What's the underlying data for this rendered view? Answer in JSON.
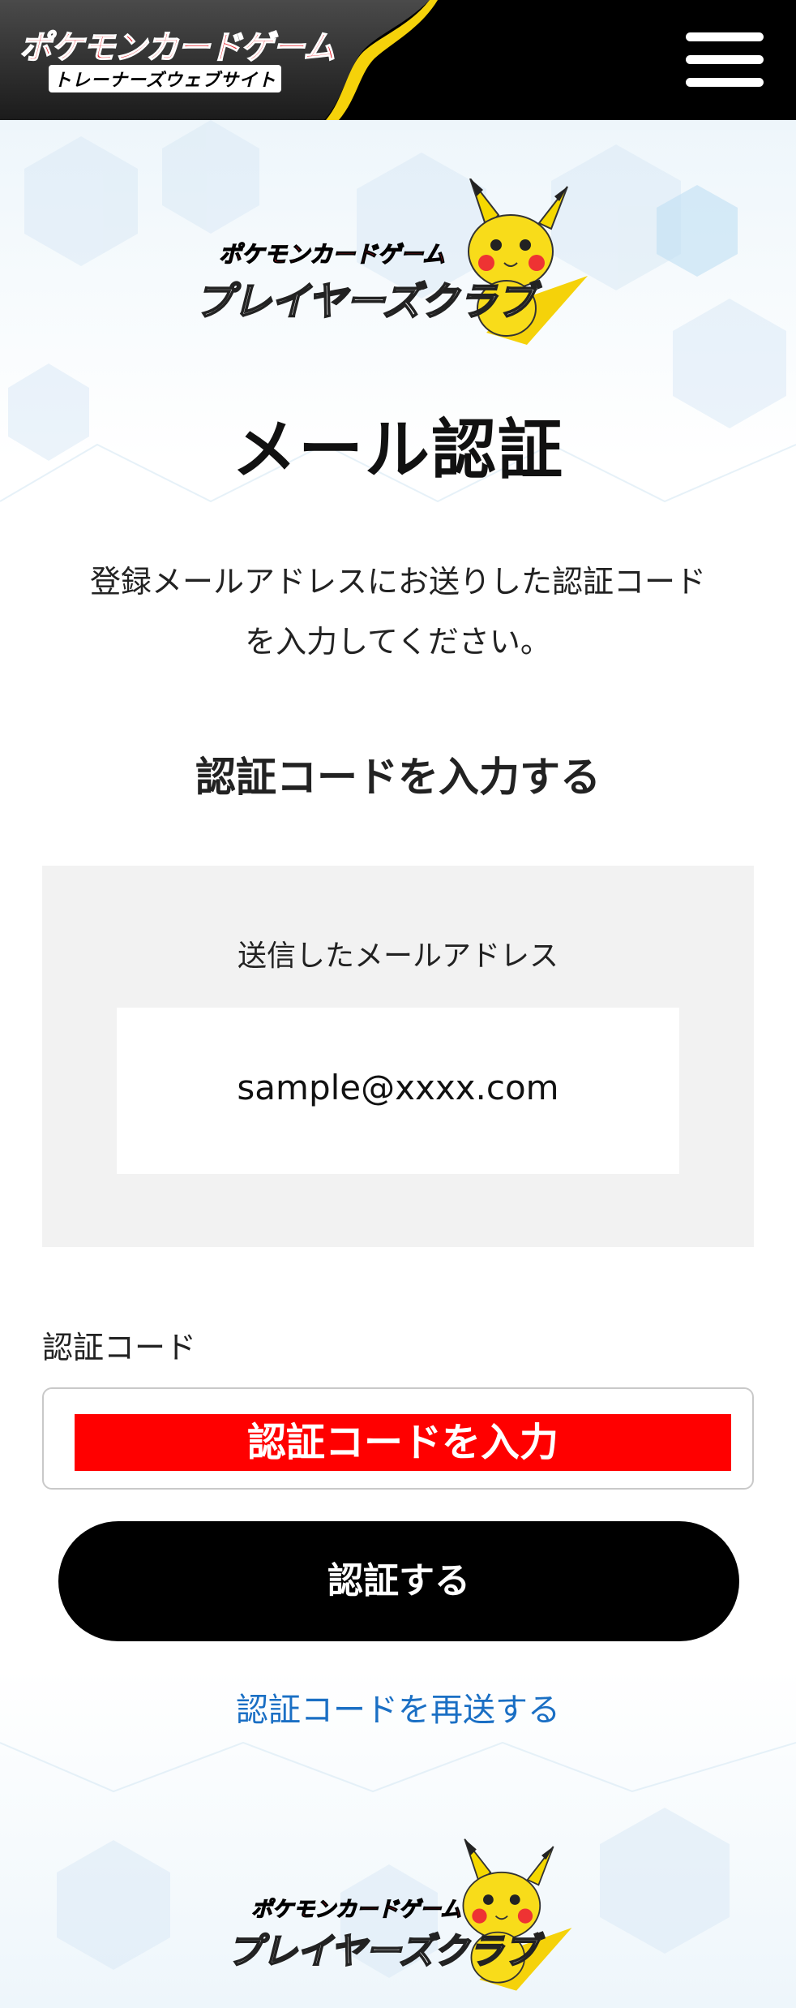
{
  "header": {
    "brand_line1": "ポケモンカードゲーム",
    "brand_line2": "トレーナーズウェブサイト",
    "menu_icon": "hamburger-menu-icon"
  },
  "club_logo": {
    "line1": "ポケモンカードゲーム",
    "line2": "プレイヤーズクラブ"
  },
  "main": {
    "title": "メール認証",
    "intro_line1": "登録メールアドレスにお送りした認証コード",
    "intro_line2": "を入力してください。",
    "section_title": "認証コードを入力する",
    "sent_email_label": "送信したメールアドレス",
    "sent_email_value": "sample@xxxx.com",
    "code_label": "認証コード",
    "code_placeholder": "認証コードを入力",
    "submit_label": "認証する",
    "resend_label": "認証コードを再送する"
  },
  "colors": {
    "header_bg": "#000000",
    "accent_yellow": "#f5d20a",
    "brand_red": "#e3202a",
    "link_blue": "#1a6fc4",
    "panel_gray": "#f2f2f2",
    "placeholder_highlight": "#ff0000"
  }
}
